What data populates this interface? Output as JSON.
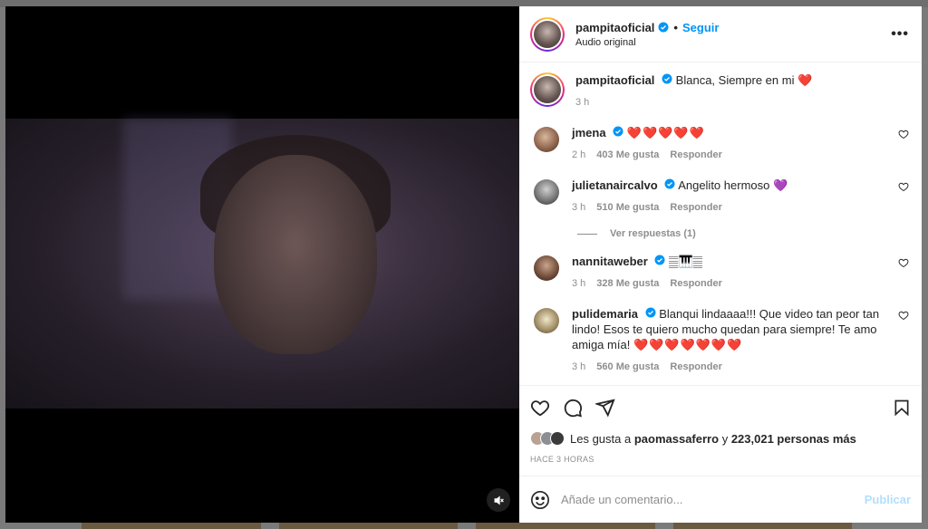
{
  "post": {
    "username": "pampitaoficial",
    "follow_label": "Seguir",
    "separator": "•",
    "audio": "Audio original",
    "more_label": "•••"
  },
  "caption": {
    "username": "pampitaoficial",
    "text": "Blanca, Siempre en mi ❤️",
    "time": "3 h"
  },
  "comments": [
    {
      "username": "jmena",
      "text": "❤️❤️❤️❤️❤️",
      "time": "2 h",
      "likes": "403 Me gusta",
      "reply": "Responder"
    },
    {
      "username": "julietanaircalvo",
      "text": "Angelito hermoso",
      "emoji": "💜",
      "time": "3 h",
      "likes": "510 Me gusta",
      "reply": "Responder"
    },
    {
      "username": "nannitaweber",
      "text": "𝄛🎹𝄛",
      "time": "3 h",
      "likes": "328 Me gusta",
      "reply": "Responder"
    },
    {
      "username": "pulidemaria",
      "text": "Blanqui lindaaaa!!! Que video tan peor tan lindo! Esos te quiero mucho quedan para siempre! Te amo amiga mía!",
      "emoji": "❤️❤️❤️❤️❤️❤️❤️",
      "time": "3 h",
      "likes": "560 Me gusta",
      "reply": "Responder"
    }
  ],
  "view_replies": "Ver respuestas (1)",
  "likes": {
    "prefix": "Les gusta a",
    "user": "paomassaferro",
    "connector": "y",
    "rest": "223,021 personas más"
  },
  "time_ago": "HACE 3 HORAS",
  "composer": {
    "placeholder": "Añade un comentario...",
    "publish": "Publicar"
  },
  "icons": {
    "verified": "verified-badge-icon",
    "heart": "heart-icon",
    "comment": "comment-icon",
    "share": "share-icon",
    "save": "bookmark-icon",
    "emoji": "emoji-icon",
    "mute": "muted-speaker-icon"
  },
  "colors": {
    "accent": "#0095f6",
    "publish_disabled": "#b2dffc",
    "muted_text": "#8e8e8e"
  }
}
